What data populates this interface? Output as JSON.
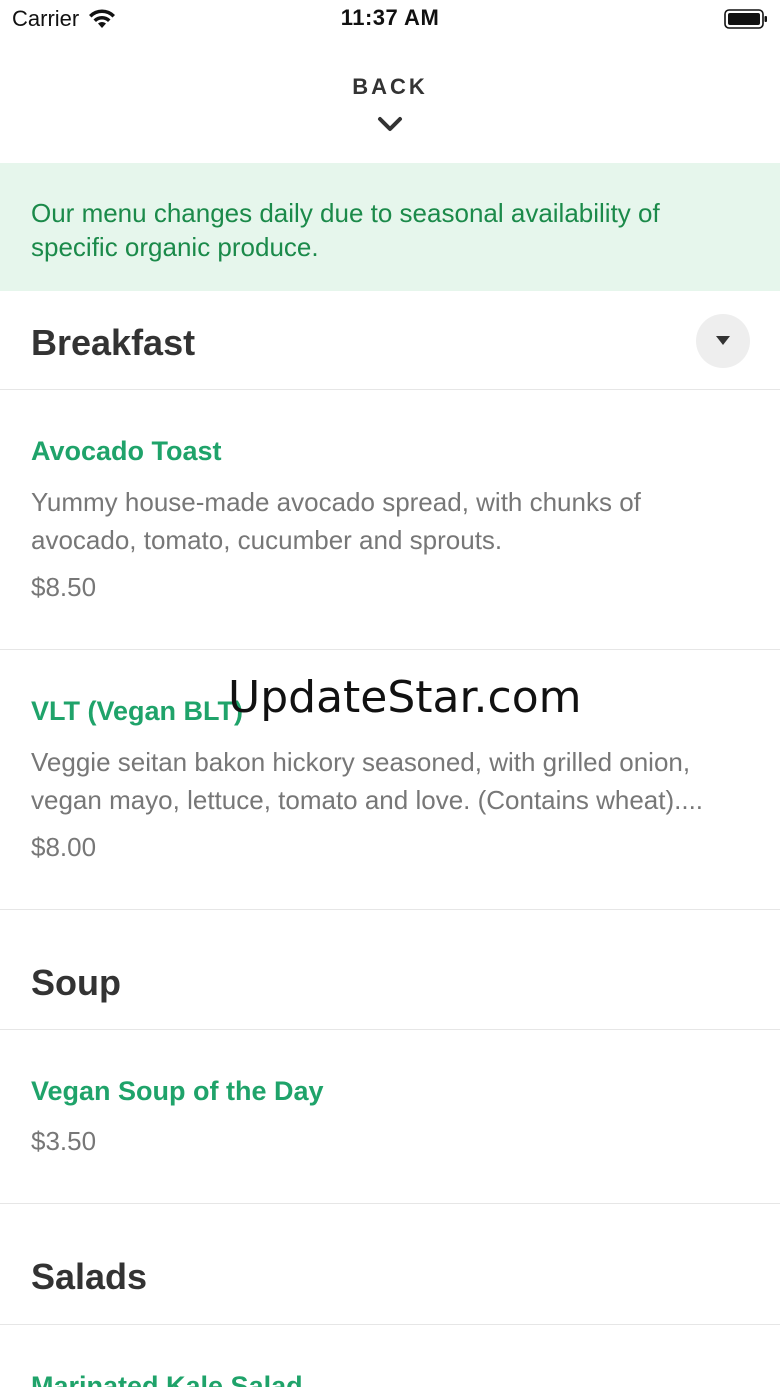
{
  "status_bar": {
    "carrier": "Carrier",
    "time": "11:37 AM"
  },
  "header": {
    "back_label": "BACK"
  },
  "notice": {
    "text": "Our menu changes daily due to seasonal availability of specific organic produce."
  },
  "sections": [
    {
      "title": "Breakfast",
      "items": [
        {
          "name": "Avocado Toast",
          "description": "Yummy house-made avocado spread, with chunks of\navocado, tomato, cucumber and sprouts.",
          "price": "$8.50"
        },
        {
          "name": "VLT (Vegan BLT)",
          "description": "Veggie seitan bakon hickory seasoned, with grilled onion,\nvegan mayo, lettuce, tomato and love. (Contains wheat)....",
          "price": "$8.00"
        }
      ]
    },
    {
      "title": "Soup",
      "items": [
        {
          "name": "Vegan Soup of the Day",
          "price": "$3.50"
        }
      ]
    },
    {
      "title": "Salads",
      "items": [
        {
          "name": "Marinated Kale Salad"
        }
      ]
    }
  ],
  "watermark": "UpdateStar.com",
  "colors": {
    "accent": "#1fa36a",
    "notice_bg": "#e6f6ec",
    "notice_text": "#1b8a4a"
  }
}
